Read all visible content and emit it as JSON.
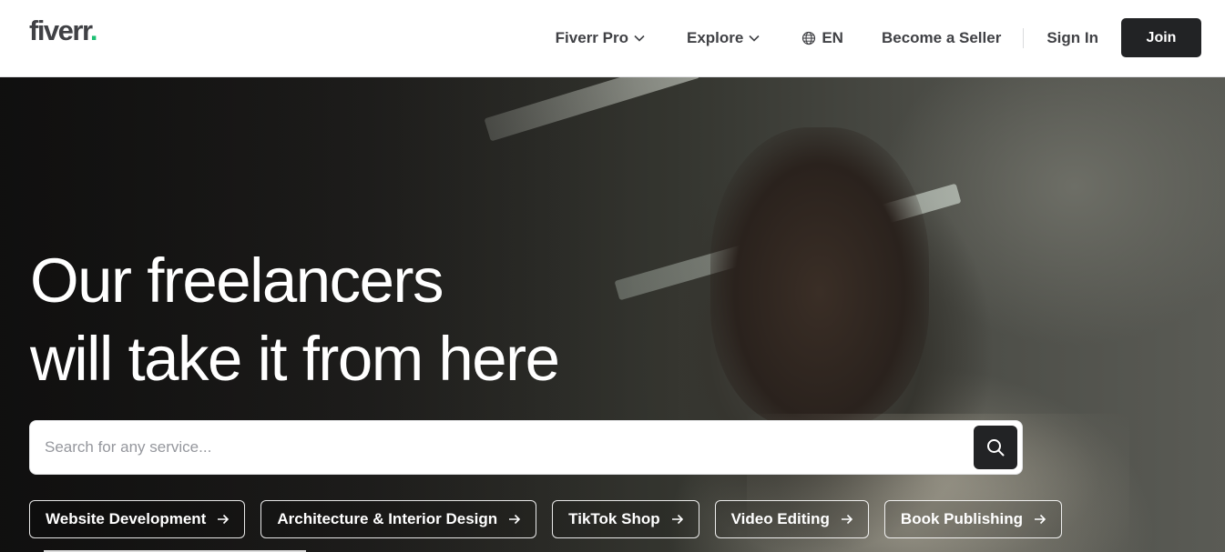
{
  "header": {
    "logo_text": "fiverr",
    "logo_dot": ".",
    "nav": {
      "pro_label": "Fiverr Pro",
      "explore_label": "Explore",
      "language_label": "EN",
      "become_seller_label": "Become a Seller",
      "sign_in_label": "Sign In",
      "join_label": "Join"
    }
  },
  "hero": {
    "headline_line1": "Our freelancers",
    "headline_line2": "will take it from here",
    "search": {
      "placeholder": "Search for any service...",
      "value": ""
    },
    "categories": [
      {
        "label": "Website Development"
      },
      {
        "label": "Architecture & Interior Design"
      },
      {
        "label": "TikTok Shop"
      },
      {
        "label": "Video Editing"
      },
      {
        "label": "Book Publishing"
      }
    ]
  },
  "icons": {
    "globe": "globe-icon",
    "chevron": "chevron-down-icon",
    "search": "search-icon",
    "arrow": "arrow-right-icon"
  },
  "colors": {
    "brand_green": "#1dbf73",
    "dark": "#222325",
    "text": "#404145"
  }
}
